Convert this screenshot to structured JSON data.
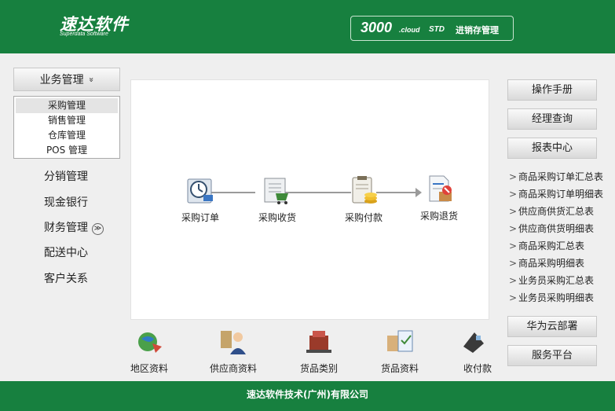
{
  "header": {
    "logo_cn": "速达软件",
    "logo_en": "Superdata Software",
    "product_num": "3000",
    "product_cloud": ".cloud",
    "product_std": "STD",
    "product_cn": "进销存管理"
  },
  "sidebar": {
    "head_label": "业务管理",
    "head_chevron": "»",
    "submenu": [
      "采购管理",
      "销售管理",
      "仓库管理",
      "POS 管理"
    ],
    "selected_index": 0,
    "items": [
      "分销管理",
      "现金银行",
      "财务管理",
      "配送中心",
      "客户关系"
    ]
  },
  "workflow": {
    "nodes": [
      "采购订单",
      "采购收货",
      "采购付款",
      "采购退货"
    ]
  },
  "quick": [
    "地区资料",
    "供应商资料",
    "货品类别",
    "货品资料",
    "收付款"
  ],
  "right": {
    "buttons_top": [
      "操作手册",
      "经理查询",
      "报表中心"
    ],
    "links": [
      "商品采购订单汇总表",
      "商品采购订单明细表",
      "供应商供货汇总表",
      "供应商供货明细表",
      "商品采购汇总表",
      "商品采购明细表",
      "业务员采购汇总表",
      "业务员采购明细表"
    ],
    "link_arrow": ">",
    "buttons_bottom": [
      "华为云部署",
      "服务平台"
    ]
  },
  "footer": {
    "text": "速达软件技术(广州)有限公司"
  }
}
